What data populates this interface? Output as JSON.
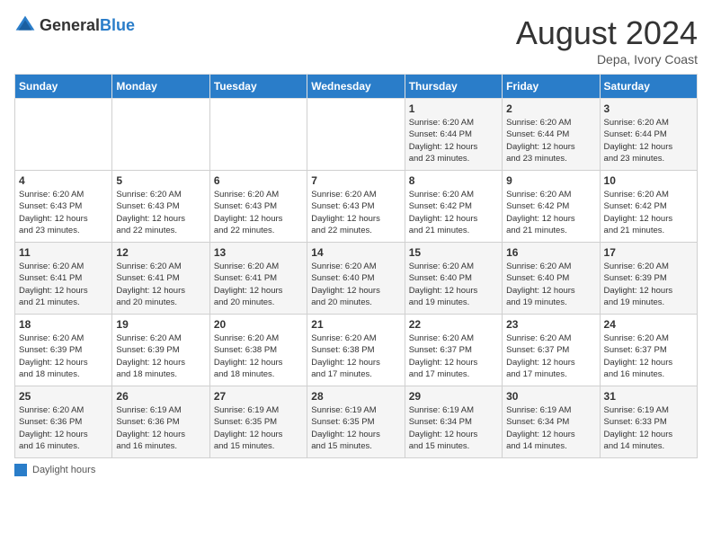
{
  "header": {
    "logo_general": "General",
    "logo_blue": "Blue",
    "month_year": "August 2024",
    "location": "Depa, Ivory Coast"
  },
  "footer": {
    "daylight_label": "Daylight hours"
  },
  "days_of_week": [
    "Sunday",
    "Monday",
    "Tuesday",
    "Wednesday",
    "Thursday",
    "Friday",
    "Saturday"
  ],
  "weeks": [
    [
      {
        "day": "",
        "info": ""
      },
      {
        "day": "",
        "info": ""
      },
      {
        "day": "",
        "info": ""
      },
      {
        "day": "",
        "info": ""
      },
      {
        "day": "1",
        "info": "Sunrise: 6:20 AM\nSunset: 6:44 PM\nDaylight: 12 hours\nand 23 minutes."
      },
      {
        "day": "2",
        "info": "Sunrise: 6:20 AM\nSunset: 6:44 PM\nDaylight: 12 hours\nand 23 minutes."
      },
      {
        "day": "3",
        "info": "Sunrise: 6:20 AM\nSunset: 6:44 PM\nDaylight: 12 hours\nand 23 minutes."
      }
    ],
    [
      {
        "day": "4",
        "info": "Sunrise: 6:20 AM\nSunset: 6:43 PM\nDaylight: 12 hours\nand 23 minutes."
      },
      {
        "day": "5",
        "info": "Sunrise: 6:20 AM\nSunset: 6:43 PM\nDaylight: 12 hours\nand 22 minutes."
      },
      {
        "day": "6",
        "info": "Sunrise: 6:20 AM\nSunset: 6:43 PM\nDaylight: 12 hours\nand 22 minutes."
      },
      {
        "day": "7",
        "info": "Sunrise: 6:20 AM\nSunset: 6:43 PM\nDaylight: 12 hours\nand 22 minutes."
      },
      {
        "day": "8",
        "info": "Sunrise: 6:20 AM\nSunset: 6:42 PM\nDaylight: 12 hours\nand 21 minutes."
      },
      {
        "day": "9",
        "info": "Sunrise: 6:20 AM\nSunset: 6:42 PM\nDaylight: 12 hours\nand 21 minutes."
      },
      {
        "day": "10",
        "info": "Sunrise: 6:20 AM\nSunset: 6:42 PM\nDaylight: 12 hours\nand 21 minutes."
      }
    ],
    [
      {
        "day": "11",
        "info": "Sunrise: 6:20 AM\nSunset: 6:41 PM\nDaylight: 12 hours\nand 21 minutes."
      },
      {
        "day": "12",
        "info": "Sunrise: 6:20 AM\nSunset: 6:41 PM\nDaylight: 12 hours\nand 20 minutes."
      },
      {
        "day": "13",
        "info": "Sunrise: 6:20 AM\nSunset: 6:41 PM\nDaylight: 12 hours\nand 20 minutes."
      },
      {
        "day": "14",
        "info": "Sunrise: 6:20 AM\nSunset: 6:40 PM\nDaylight: 12 hours\nand 20 minutes."
      },
      {
        "day": "15",
        "info": "Sunrise: 6:20 AM\nSunset: 6:40 PM\nDaylight: 12 hours\nand 19 minutes."
      },
      {
        "day": "16",
        "info": "Sunrise: 6:20 AM\nSunset: 6:40 PM\nDaylight: 12 hours\nand 19 minutes."
      },
      {
        "day": "17",
        "info": "Sunrise: 6:20 AM\nSunset: 6:39 PM\nDaylight: 12 hours\nand 19 minutes."
      }
    ],
    [
      {
        "day": "18",
        "info": "Sunrise: 6:20 AM\nSunset: 6:39 PM\nDaylight: 12 hours\nand 18 minutes."
      },
      {
        "day": "19",
        "info": "Sunrise: 6:20 AM\nSunset: 6:39 PM\nDaylight: 12 hours\nand 18 minutes."
      },
      {
        "day": "20",
        "info": "Sunrise: 6:20 AM\nSunset: 6:38 PM\nDaylight: 12 hours\nand 18 minutes."
      },
      {
        "day": "21",
        "info": "Sunrise: 6:20 AM\nSunset: 6:38 PM\nDaylight: 12 hours\nand 17 minutes."
      },
      {
        "day": "22",
        "info": "Sunrise: 6:20 AM\nSunset: 6:37 PM\nDaylight: 12 hours\nand 17 minutes."
      },
      {
        "day": "23",
        "info": "Sunrise: 6:20 AM\nSunset: 6:37 PM\nDaylight: 12 hours\nand 17 minutes."
      },
      {
        "day": "24",
        "info": "Sunrise: 6:20 AM\nSunset: 6:37 PM\nDaylight: 12 hours\nand 16 minutes."
      }
    ],
    [
      {
        "day": "25",
        "info": "Sunrise: 6:20 AM\nSunset: 6:36 PM\nDaylight: 12 hours\nand 16 minutes."
      },
      {
        "day": "26",
        "info": "Sunrise: 6:19 AM\nSunset: 6:36 PM\nDaylight: 12 hours\nand 16 minutes."
      },
      {
        "day": "27",
        "info": "Sunrise: 6:19 AM\nSunset: 6:35 PM\nDaylight: 12 hours\nand 15 minutes."
      },
      {
        "day": "28",
        "info": "Sunrise: 6:19 AM\nSunset: 6:35 PM\nDaylight: 12 hours\nand 15 minutes."
      },
      {
        "day": "29",
        "info": "Sunrise: 6:19 AM\nSunset: 6:34 PM\nDaylight: 12 hours\nand 15 minutes."
      },
      {
        "day": "30",
        "info": "Sunrise: 6:19 AM\nSunset: 6:34 PM\nDaylight: 12 hours\nand 14 minutes."
      },
      {
        "day": "31",
        "info": "Sunrise: 6:19 AM\nSunset: 6:33 PM\nDaylight: 12 hours\nand 14 minutes."
      }
    ]
  ]
}
